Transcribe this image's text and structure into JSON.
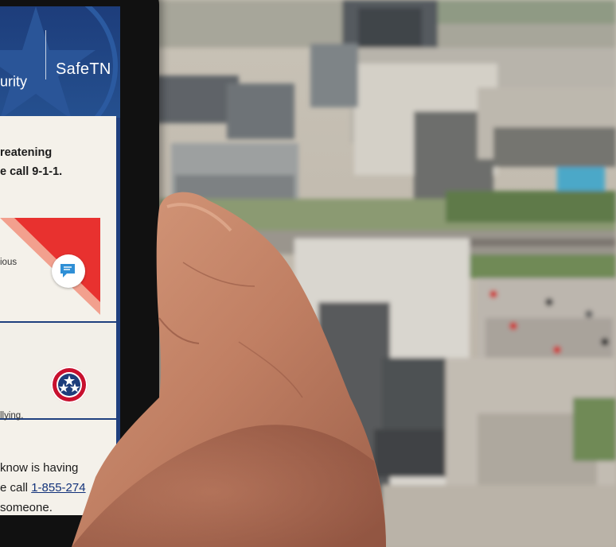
{
  "header": {
    "brand_left": "urity",
    "brand_right": "SafeTN"
  },
  "card1": {
    "line1": "reatening",
    "line2": "e call 9-1-1.",
    "small_text": "ious",
    "icon": "chat-bubble-icon"
  },
  "card2": {
    "small_text": "llying.",
    "icon": "tennessee-tristar-seal-icon"
  },
  "card3": {
    "line1": "know is having",
    "line2_prefix": "e call ",
    "line2_link": "1-855-274",
    "line3": "someone."
  },
  "colors": {
    "header_blue": "#1f3f7e",
    "alert_red": "#e8312f",
    "card_bg": "#f4f1ea",
    "link_blue": "#12327a"
  }
}
